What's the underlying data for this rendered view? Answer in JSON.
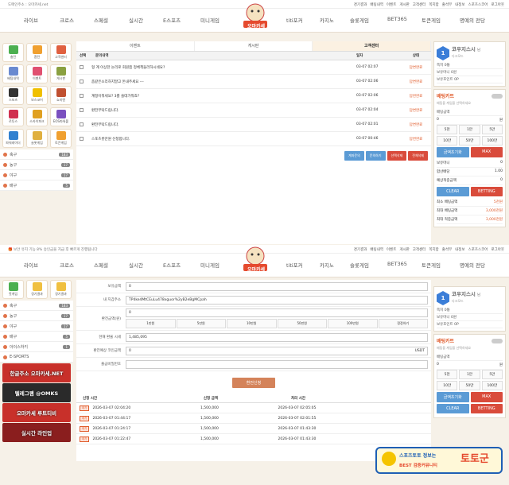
{
  "top": {
    "notice": "도메인주소 : 오마카세.net",
    "notice2": "🎁 보안 유지 기능 8% 승인금을 지급 후 빠르게 진행됩니다",
    "links": [
      "경기결과",
      "배팅내역",
      "이벤트",
      "게시판",
      "고객센터",
      "쪽지함",
      "출석부",
      "내정보",
      "스포츠스코어",
      "로그아웃"
    ]
  },
  "logo": {
    "top": "SPORTS & CASINO",
    "name": "오마카세"
  },
  "nav": [
    "라이브",
    "크로스",
    "스페셜",
    "실시간",
    "E스포츠",
    "미니게임",
    "",
    "titi포커",
    "카지노",
    "슬롯게임",
    "BET365",
    "토큰게임",
    "명예의 전당"
  ],
  "grid1": [
    "충전",
    "환전",
    "고객센터",
    "배팅내역",
    "이벤트",
    "게시판",
    "스포츠",
    "보스코어",
    "쇼미엔",
    "로투스",
    "스카이파크",
    "EOS파워볼",
    "파워레이더",
    "슬롯게임",
    "토큰게임",
    "핫게임",
    "경기결과",
    "경기결과"
  ],
  "sports": [
    {
      "name": "축구",
      "count": "183"
    },
    {
      "name": "농구",
      "count": "17"
    },
    {
      "name": "야구",
      "count": "17"
    },
    {
      "name": "배구",
      "count": "5"
    }
  ],
  "sports2": [
    {
      "name": "축구",
      "count": "183"
    },
    {
      "name": "농구",
      "count": "17"
    },
    {
      "name": "야구",
      "count": "17"
    },
    {
      "name": "배구",
      "count": "5"
    },
    {
      "name": "아이스하키",
      "count": "1"
    },
    {
      "name": "E-SPORTS",
      "count": ""
    }
  ],
  "tabs": [
    "이벤트",
    "게시판",
    "고객센터"
  ],
  "board": {
    "headers": [
      "선택",
      "문의내역",
      "일자",
      "상태"
    ],
    "rows": [
      {
        "title": "형 계 이상한 논리로 회원쯤 정체책들라하시네요?",
        "date": "03-07 02:07",
        "status": "답변완료"
      },
      {
        "title": "좀같은소리하지말고 돈내주세요 ---",
        "date": "03-07 02:06",
        "status": "답변완료"
      },
      {
        "title": "계정이뭐세요? 3를 쓸데가뭐죠?",
        "date": "03-07 02:06",
        "status": "답변완료"
      },
      {
        "title": "환전부탁드립니다.",
        "date": "03-07 02:04",
        "status": "답변완료"
      },
      {
        "title": "환전부탁드립니다.",
        "date": "03-07 02:01",
        "status": "답변완료"
      },
      {
        "title": "스포츠롯만원 신청합니다.",
        "date": "03-07 00:46",
        "status": "답변완료"
      }
    ],
    "buttons": [
      "계좌문의",
      "문의하기",
      "선택삭제",
      "전체삭제"
    ]
  },
  "user": {
    "name": "코우지스시",
    "suffix": "님",
    "level": "1",
    "grade": "다크모드",
    "notes": "쪽지 0통",
    "money": "보유머니 0원",
    "point": "보유포인트 0P"
  },
  "slip": {
    "title": "배팅카트",
    "sub": "배팅을 계임을 선택하세요",
    "amount_label": "배팅금액",
    "amount": "0",
    "unit": "원",
    "quick": [
      "5천",
      "1만",
      "5만",
      "10만",
      "50만",
      "100만"
    ],
    "reset": "금액초기화",
    "max": "MAX",
    "rows": [
      {
        "k": "보유머니",
        "v": "0"
      },
      {
        "k": "합산배당",
        "v": "1.00"
      },
      {
        "k": "예상적중금액",
        "v": "0"
      }
    ],
    "clear": "CLEAR",
    "betting": "BETTING",
    "limits": [
      {
        "k": "최소 배팅금액",
        "v": "5천원"
      },
      {
        "k": "최대 배팅금액",
        "v": "3,000천원"
      },
      {
        "k": "최대 적중금액",
        "v": "3,000천원"
      }
    ]
  },
  "withdraw": {
    "rows": [
      {
        "label": "보유금액",
        "value": "0"
      },
      {
        "label": "내 지갑주소",
        "value": "TP4ke4MtCEuLu478xguor%2yB2eBgMCpah"
      },
      {
        "label": "환전금액(원)",
        "value": "0"
      },
      {
        "label": "현재 환율 시세",
        "value": "1,485,095"
      },
      {
        "label": "환전예상 코인금액",
        "value": "0"
      },
      {
        "label": "출금비밀번호",
        "value": ""
      }
    ],
    "quick": [
      "1만원",
      "5만원",
      "10만원",
      "50만원",
      "100만원",
      "정정하기"
    ],
    "coin_unit": "USDT",
    "submit": "환전신청",
    "history_headers": [
      "신청 시간",
      "신청 금액",
      "처리 시간"
    ],
    "history": [
      {
        "tag": "대기",
        "req": "2026-03-07 02:04:20",
        "amt": "1,500,000",
        "done": "2026-03-07 02:05:05"
      },
      {
        "tag": "대기",
        "req": "2026-03-07 01:44:17",
        "amt": "1,500,000",
        "done": "2026-03-07 02:01:55"
      },
      {
        "tag": "대기",
        "req": "2026-03-07 01:24:17",
        "amt": "1,500,000",
        "done": "2026-03-07 01:43:30"
      },
      {
        "tag": "대기",
        "req": "2026-03-07 01:22:47",
        "amt": "1,500,000",
        "done": "2026-03-07 01:43:30"
      }
    ]
  },
  "banners": [
    "한글주소 오마카세.NET",
    "텔레그램 @OMKS",
    "오마카세 루트티비",
    "실시간 라인업"
  ],
  "watermark": {
    "line1": "스포츠토토 정보는",
    "line2": "토토군",
    "line3": "BEST 검증커뮤니티"
  },
  "colors": {
    "accent": "#e05b2b",
    "blue": "#5b9bd5",
    "red": "#d94b3b"
  }
}
